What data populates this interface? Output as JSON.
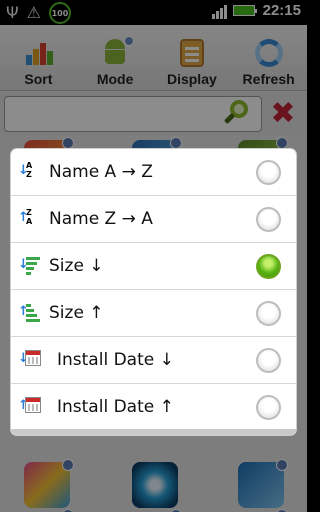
{
  "status_bar": {
    "battery_badge": "100",
    "time": "22:15",
    "icons": [
      "usb-icon",
      "warning-icon",
      "battery-badge",
      "signal-icon",
      "battery-icon"
    ]
  },
  "toolbar": {
    "items": [
      {
        "label": "Sort",
        "icon": "bar-chart-icon"
      },
      {
        "label": "Mode",
        "icon": "android-icon"
      },
      {
        "label": "Display",
        "icon": "clipboard-icon"
      },
      {
        "label": "Refresh",
        "icon": "refresh-icon"
      }
    ]
  },
  "search": {
    "value": "",
    "placeholder": "",
    "search_icon": "magnifier-icon",
    "clear_icon": "clear-x-icon"
  },
  "sort_dialog": {
    "options": [
      {
        "label": "Name A → Z",
        "icon": "sort-name-asc-icon",
        "selected": false
      },
      {
        "label": "Name Z → A",
        "icon": "sort-name-desc-icon",
        "selected": false
      },
      {
        "label": "Size ↓",
        "icon": "sort-size-desc-icon",
        "selected": true
      },
      {
        "label": "Size ↑",
        "icon": "sort-size-asc-icon",
        "selected": false
      },
      {
        "label": "Install Date ↓",
        "icon": "calendar-desc-icon",
        "selected": false
      },
      {
        "label": "Install Date ↑",
        "icon": "calendar-asc-icon",
        "selected": false
      }
    ]
  },
  "colors": {
    "accent_green": "#58b513",
    "clear_red": "#c0243a",
    "toolbar_bg": "#e6e6e6"
  }
}
